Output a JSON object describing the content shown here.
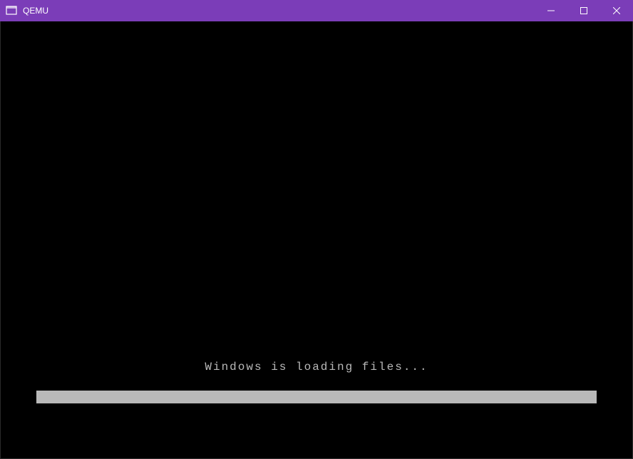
{
  "window": {
    "title": "QEMU"
  },
  "main": {
    "loading_message": "Windows is loading files...",
    "progress_percent": 100
  },
  "colors": {
    "titlebar": "#7b3db8",
    "content_bg": "#000000",
    "text": "#b9b9b9",
    "progress": "#b9b9b9"
  }
}
